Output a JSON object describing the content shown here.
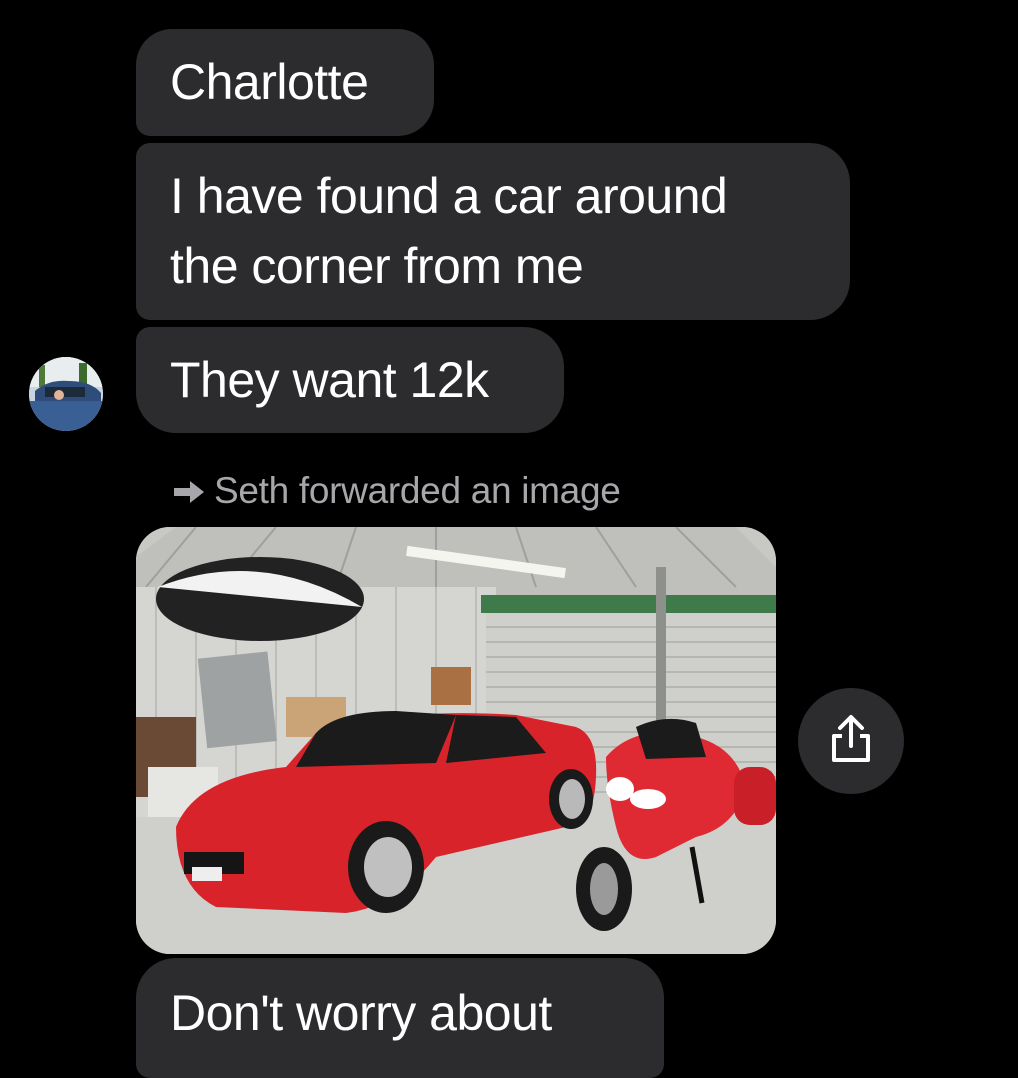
{
  "messages": [
    {
      "sender": "other",
      "text": "Charlotte"
    },
    {
      "sender": "other",
      "text": "I have found a car around the corner from me",
      "lines": [
        "I have found a car around",
        "the corner from me"
      ]
    },
    {
      "sender": "other",
      "text": "They want 12k"
    },
    {
      "sender": "other",
      "text": "Don't worry about"
    }
  ],
  "forwarded": {
    "label": "Seth forwarded an image",
    "icon": "forward-arrow-icon"
  },
  "image_message": {
    "share_icon": "share-icon"
  },
  "colors": {
    "background": "#000000",
    "bubble": "#2c2c2e",
    "meta_text": "#a7a7ab"
  }
}
